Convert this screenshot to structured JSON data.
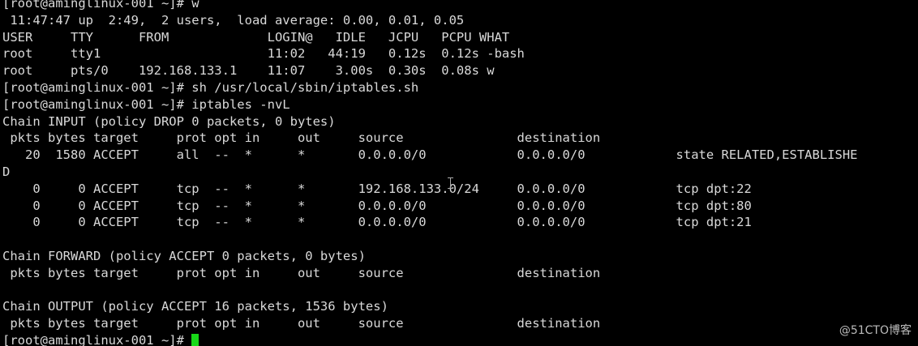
{
  "terminal": {
    "lines": [
      "[root@aminglinux-001 ~]# w",
      " 11:47:47 up  2:49,  2 users,  load average: 0.00, 0.01, 0.05",
      "USER     TTY      FROM             LOGIN@   IDLE   JCPU   PCPU WHAT",
      "root     tty1                      11:02   44:19   0.12s  0.12s -bash",
      "root     pts/0    192.168.133.1    11:07    3.00s  0.30s  0.08s w",
      "[root@aminglinux-001 ~]# sh /usr/local/sbin/iptables.sh",
      "[root@aminglinux-001 ~]# iptables -nvL",
      "Chain INPUT (policy DROP 0 packets, 0 bytes)",
      " pkts bytes target     prot opt in     out     source               destination",
      "   20  1580 ACCEPT     all  --  *      *       0.0.0.0/0            0.0.0.0/0            state RELATED,ESTABLISHE",
      "D",
      "    0     0 ACCEPT     tcp  --  *      *       192.168.133.0/24     0.0.0.0/0            tcp dpt:22",
      "    0     0 ACCEPT     tcp  --  *      *       0.0.0.0/0            0.0.0.0/0            tcp dpt:80",
      "    0     0 ACCEPT     tcp  --  *      *       0.0.0.0/0            0.0.0.0/0            tcp dpt:21",
      "",
      "Chain FORWARD (policy ACCEPT 0 packets, 0 bytes)",
      " pkts bytes target     prot opt in     out     source               destination",
      "",
      "Chain OUTPUT (policy ACCEPT 16 packets, 1536 bytes)",
      " pkts bytes target     prot opt in     out     source               destination"
    ],
    "prompt": "[root@aminglinux-001 ~]# ",
    "colors": {
      "background": "#000000",
      "foreground": "#d9d9d9",
      "cursor": "#18d818"
    }
  },
  "watermark": {
    "text": "@51CTO博客"
  }
}
